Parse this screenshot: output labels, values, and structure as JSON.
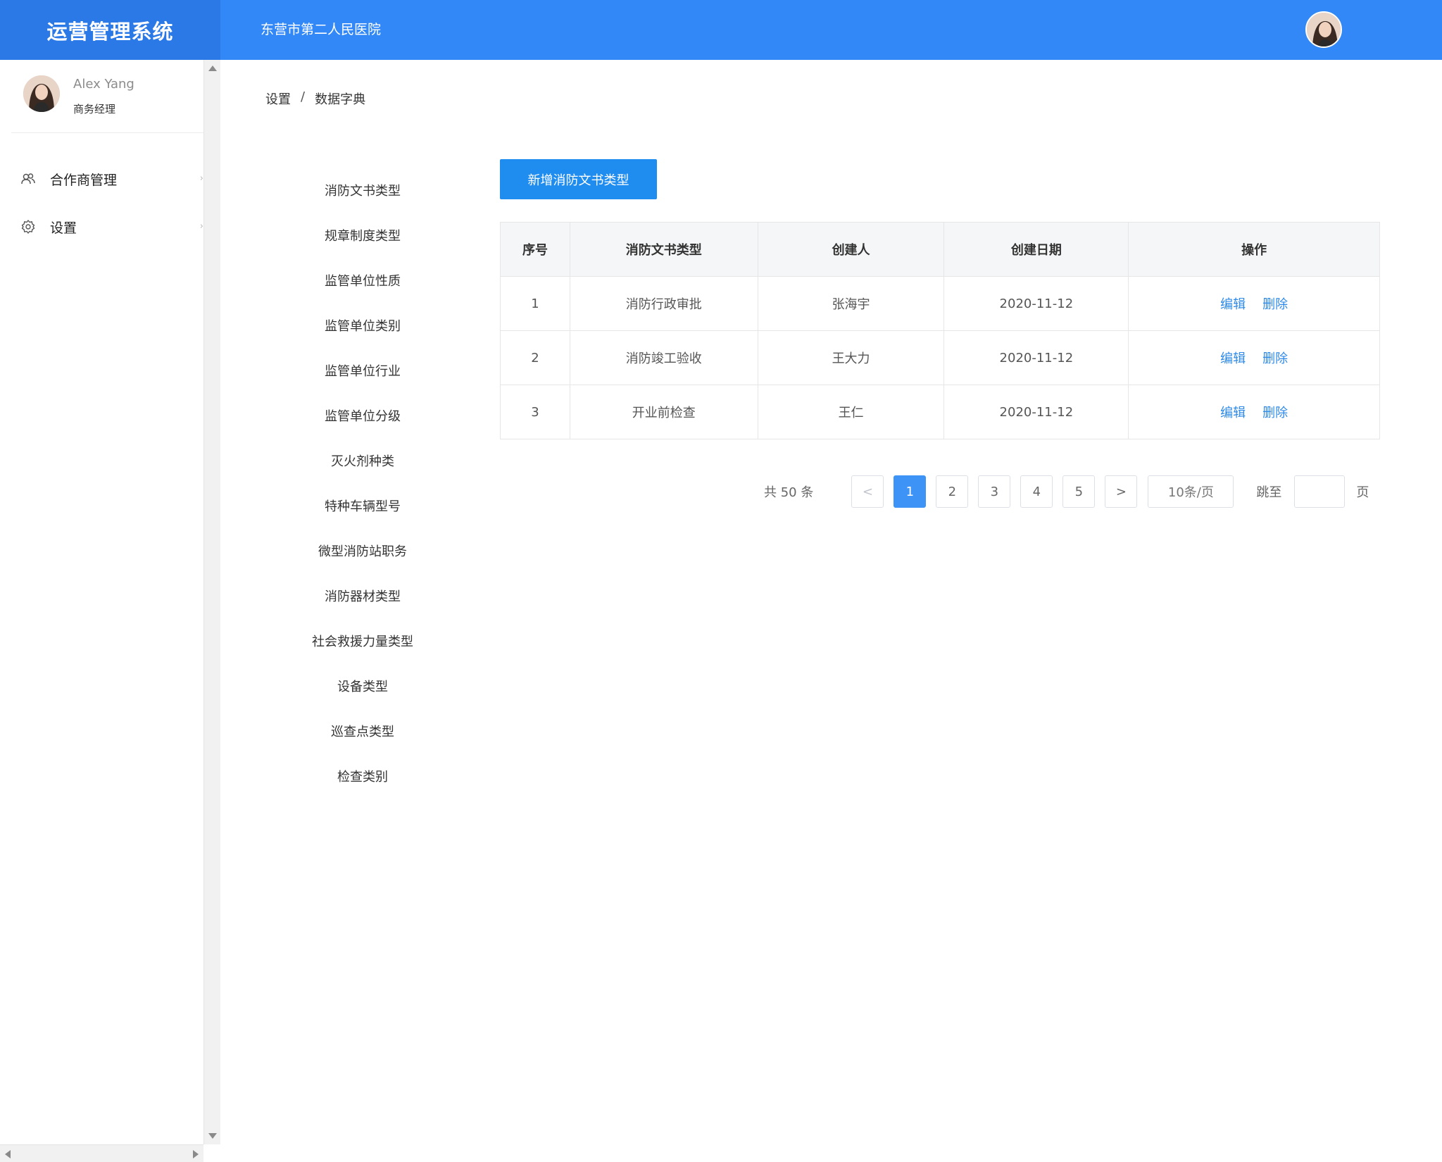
{
  "app": {
    "brand": "运营管理系统",
    "org_name": "东营市第二人民医院"
  },
  "user": {
    "name": "Alex Yang",
    "role": "商务经理"
  },
  "sidebar": {
    "items": [
      {
        "label": "合作商管理",
        "icon": "users-icon"
      },
      {
        "label": "设置",
        "icon": "gear-icon"
      }
    ]
  },
  "breadcrumb": {
    "items": [
      "设置",
      "数据字典"
    ],
    "separator": "/"
  },
  "categories": [
    "消防文书类型",
    "规章制度类型",
    "监管单位性质",
    "监管单位类别",
    "监管单位行业",
    "监管单位分级",
    "灭火剂种类",
    "特种车辆型号",
    "微型消防站职务",
    "消防器材类型",
    "社会救援力量类型",
    "设备类型",
    "巡查点类型",
    "检查类别"
  ],
  "toolbar": {
    "add_label": "新增消防文书类型"
  },
  "table": {
    "headers": [
      "序号",
      "消防文书类型",
      "创建人",
      "创建日期",
      "操作"
    ],
    "rows": [
      {
        "idx": "1",
        "type": "消防行政审批",
        "creator": "张海宇",
        "date": "2020-11-12"
      },
      {
        "idx": "2",
        "type": "消防竣工验收",
        "creator": "王大力",
        "date": "2020-11-12"
      },
      {
        "idx": "3",
        "type": "开业前检查",
        "creator": "王仁",
        "date": "2020-11-12"
      }
    ],
    "edit_label": "编辑",
    "delete_label": "删除"
  },
  "pagination": {
    "total_text": "共 50 条",
    "prev": "<",
    "pages": [
      "1",
      "2",
      "3",
      "4",
      "5"
    ],
    "current": "1",
    "next": ">",
    "page_size": "10条/页",
    "jump_label": "跳至",
    "page_suffix": "页"
  },
  "colors": {
    "header": "#3388f7",
    "brand_bg": "#2b79e6",
    "primary": "#1f8cf0",
    "link": "#2e8ae6"
  }
}
